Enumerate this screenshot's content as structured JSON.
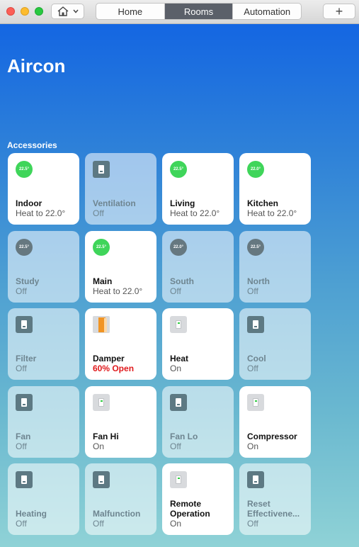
{
  "toolbar": {
    "home_button_icon": "house-icon",
    "home_button_chevron": "chevron-down-icon",
    "tabs": [
      {
        "label": "Home",
        "active": false
      },
      {
        "label": "Rooms",
        "active": true
      },
      {
        "label": "Automation",
        "active": false
      }
    ],
    "add_label": "+"
  },
  "room": {
    "title": "Aircon",
    "section_label": "Accessories"
  },
  "colors": {
    "on_status_green": "#3fd55a",
    "alert_red": "#e0191c",
    "background_top": "#1466e2",
    "background_bottom": "#8fd2d6"
  },
  "accessories": [
    {
      "name": "Indoor",
      "status": "Heat to 22.0°",
      "on": true,
      "icon": "thermostat-icon",
      "reading": "22.5°"
    },
    {
      "name": "Ventilation",
      "status": "Off",
      "on": false,
      "icon": "switch-icon"
    },
    {
      "name": "Living",
      "status": "Heat to 22.0°",
      "on": true,
      "icon": "thermostat-icon",
      "reading": "22.5°"
    },
    {
      "name": "Kitchen",
      "status": "Heat to 22.0°",
      "on": true,
      "icon": "thermostat-icon",
      "reading": "22.0°"
    },
    {
      "name": "Study",
      "status": "Off",
      "on": false,
      "icon": "thermostat-icon",
      "reading": "22.5°"
    },
    {
      "name": "Main",
      "status": "Heat to 22.0°",
      "on": true,
      "icon": "thermostat-icon",
      "reading": "22.5°"
    },
    {
      "name": "South",
      "status": "Off",
      "on": false,
      "icon": "thermostat-icon",
      "reading": "22.0°"
    },
    {
      "name": "North",
      "status": "Off",
      "on": false,
      "icon": "thermostat-icon",
      "reading": "22.5°"
    },
    {
      "name": "Filter",
      "status": "Off",
      "on": false,
      "icon": "switch-icon"
    },
    {
      "name": "Damper",
      "status": "60% Open",
      "on": true,
      "icon": "damper-icon",
      "alert": true
    },
    {
      "name": "Heat",
      "status": "On",
      "on": true,
      "icon": "switch-icon"
    },
    {
      "name": "Cool",
      "status": "Off",
      "on": false,
      "icon": "switch-icon"
    },
    {
      "name": "Fan",
      "status": "Off",
      "on": false,
      "icon": "switch-icon"
    },
    {
      "name": "Fan Hi",
      "status": "On",
      "on": true,
      "icon": "switch-icon"
    },
    {
      "name": "Fan Lo",
      "status": "Off",
      "on": false,
      "icon": "switch-icon"
    },
    {
      "name": "Compressor",
      "status": "On",
      "on": true,
      "icon": "switch-icon"
    },
    {
      "name": "Heating",
      "status": "Off",
      "on": false,
      "icon": "switch-icon"
    },
    {
      "name": "Malfunction",
      "status": "Off",
      "on": false,
      "icon": "switch-icon"
    },
    {
      "name": "Remote Operation",
      "status": "On",
      "on": true,
      "icon": "switch-icon",
      "two_line": true
    },
    {
      "name": "Reset Effectivene...",
      "status": "Off",
      "on": false,
      "icon": "switch-icon",
      "two_line": true
    }
  ]
}
